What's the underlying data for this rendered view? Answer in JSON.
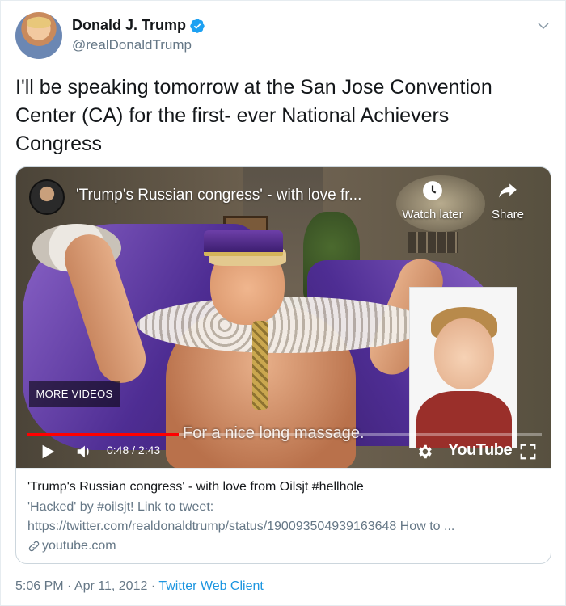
{
  "user": {
    "display_name": "Donald J. Trump",
    "handle": "@realDonaldTrump",
    "verified": true
  },
  "tweet": {
    "text": "I'll be speaking tomorrow at the San Jose Convention Center (CA) for the first- ever National Achievers Congress"
  },
  "video": {
    "title": "'Trump's Russian congress' - with love fr...",
    "watch_later_label": "Watch later",
    "share_label": "Share",
    "more_videos_label": "MORE VIDEOS",
    "subtitle": "For a nice long massage.",
    "current_time": "0:48",
    "duration": "2:43",
    "time_text": "0:48 / 2:43",
    "progress_fraction": 0.294,
    "logo_text": "YouTube"
  },
  "link_card": {
    "title": "'Trump's Russian congress' - with love from Oilsjt #hellhole",
    "description": "'Hacked' by #oilsjt! Link to tweet: https://twitter.com/realdonaldtrump/status/190093504939163648 How to ...",
    "domain": "youtube.com"
  },
  "meta": {
    "time": "5:06 PM",
    "separator": "·",
    "date": "Apr 11, 2012",
    "source": "Twitter Web Client"
  },
  "colors": {
    "link_blue": "#1b95e0",
    "verified_blue": "#1da1f2",
    "progress_red": "#ff0000",
    "secondary_text": "#657786"
  },
  "icons": {
    "verified": "verified-badge-icon",
    "chevron": "chevron-down-icon",
    "watch_later": "clock-icon",
    "share": "share-arrow-icon",
    "play": "play-icon",
    "volume": "volume-icon",
    "settings": "gear-icon",
    "fullscreen": "fullscreen-icon",
    "link": "link-chain-icon"
  }
}
